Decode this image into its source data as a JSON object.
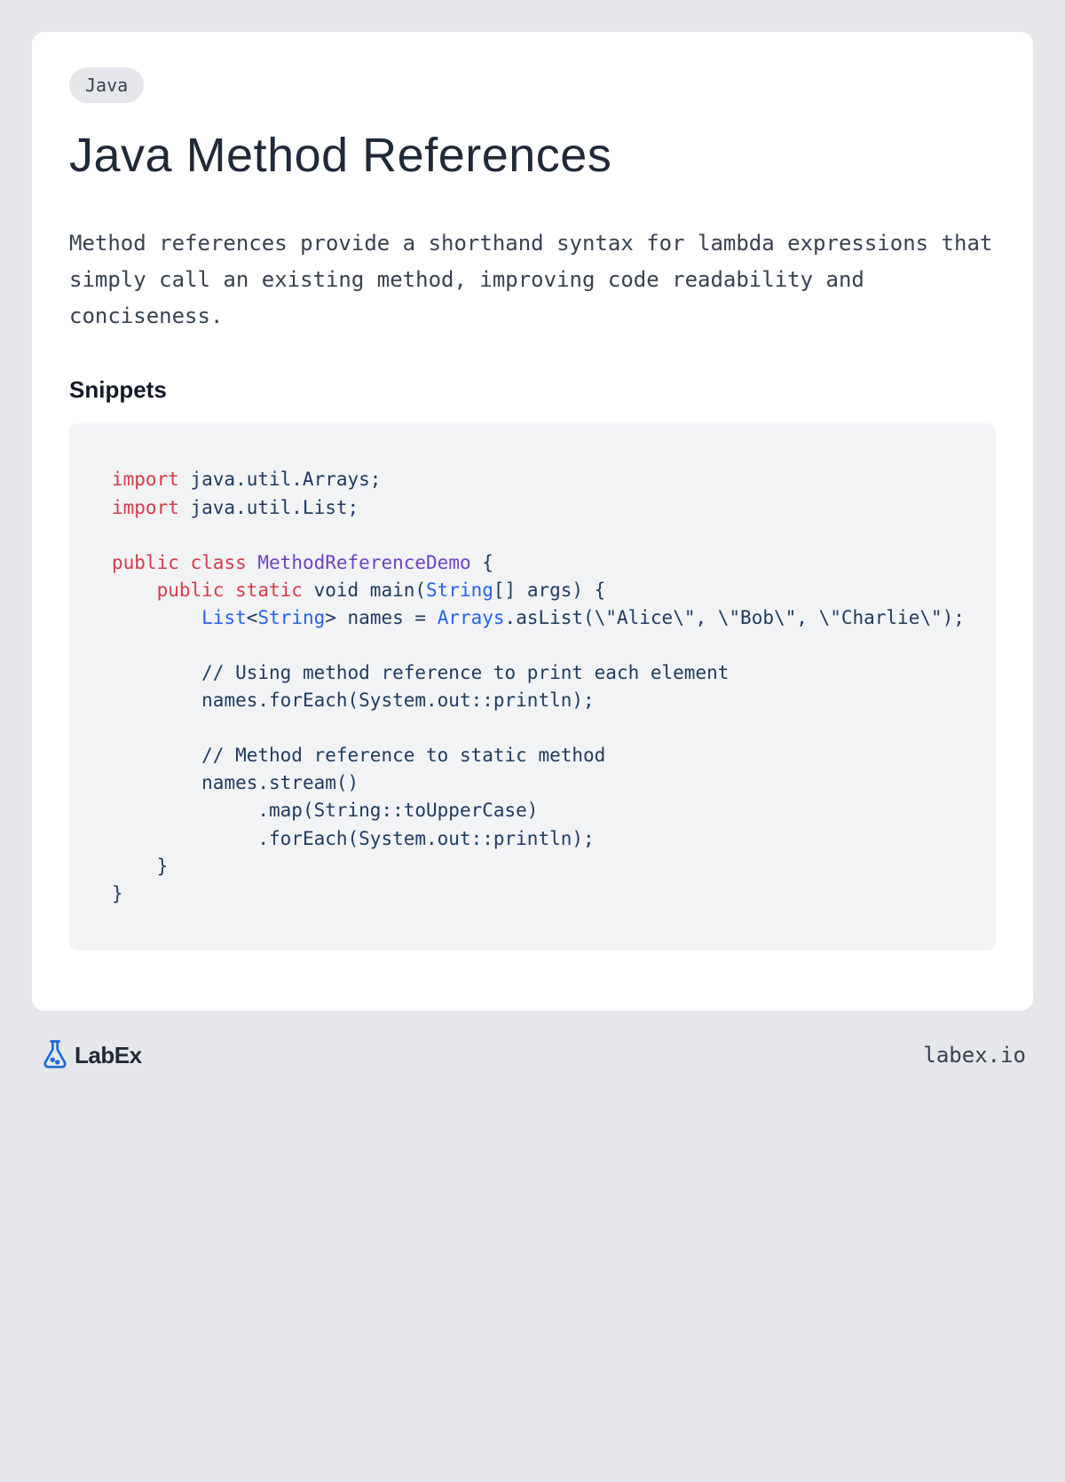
{
  "tag": "Java",
  "title": "Java Method References",
  "description": "Method references provide a shorthand syntax for lambda expressions that simply call an existing method, improving code readability and conciseness.",
  "section_title": "Snippets",
  "code": {
    "l1_kw": "import",
    "l1_rest": " java.util.Arrays;",
    "l2_kw": "import",
    "l2_rest": " java.util.List;",
    "l4_public": "public",
    "l4_class": "class",
    "l4_name": "MethodReferenceDemo",
    "l4_rest": " {",
    "l5_indent": "    ",
    "l5_public": "public",
    "l5_static": "static",
    "l5_void": " void main(",
    "l5_string": "String",
    "l5_rest": "[] args) {",
    "l6_indent": "        ",
    "l6_list": "List",
    "l6_lt": "<",
    "l6_string": "String",
    "l6_mid": "> names = ",
    "l6_arrays": "Arrays",
    "l6_rest": ".asList(\\\"Alice\\\", \\\"Bob\\\", \\\"Charlie\\\");",
    "l8": "        // Using method reference to print each element",
    "l9": "        names.forEach(System.out::println);",
    "l11": "        // Method reference to static method",
    "l12": "        names.stream()",
    "l13": "             .map(String::toUpperCase)",
    "l14": "             .forEach(System.out::println);",
    "l15": "    }",
    "l16": "}"
  },
  "footer": {
    "brand": "LabEx",
    "url": "labex.io"
  }
}
